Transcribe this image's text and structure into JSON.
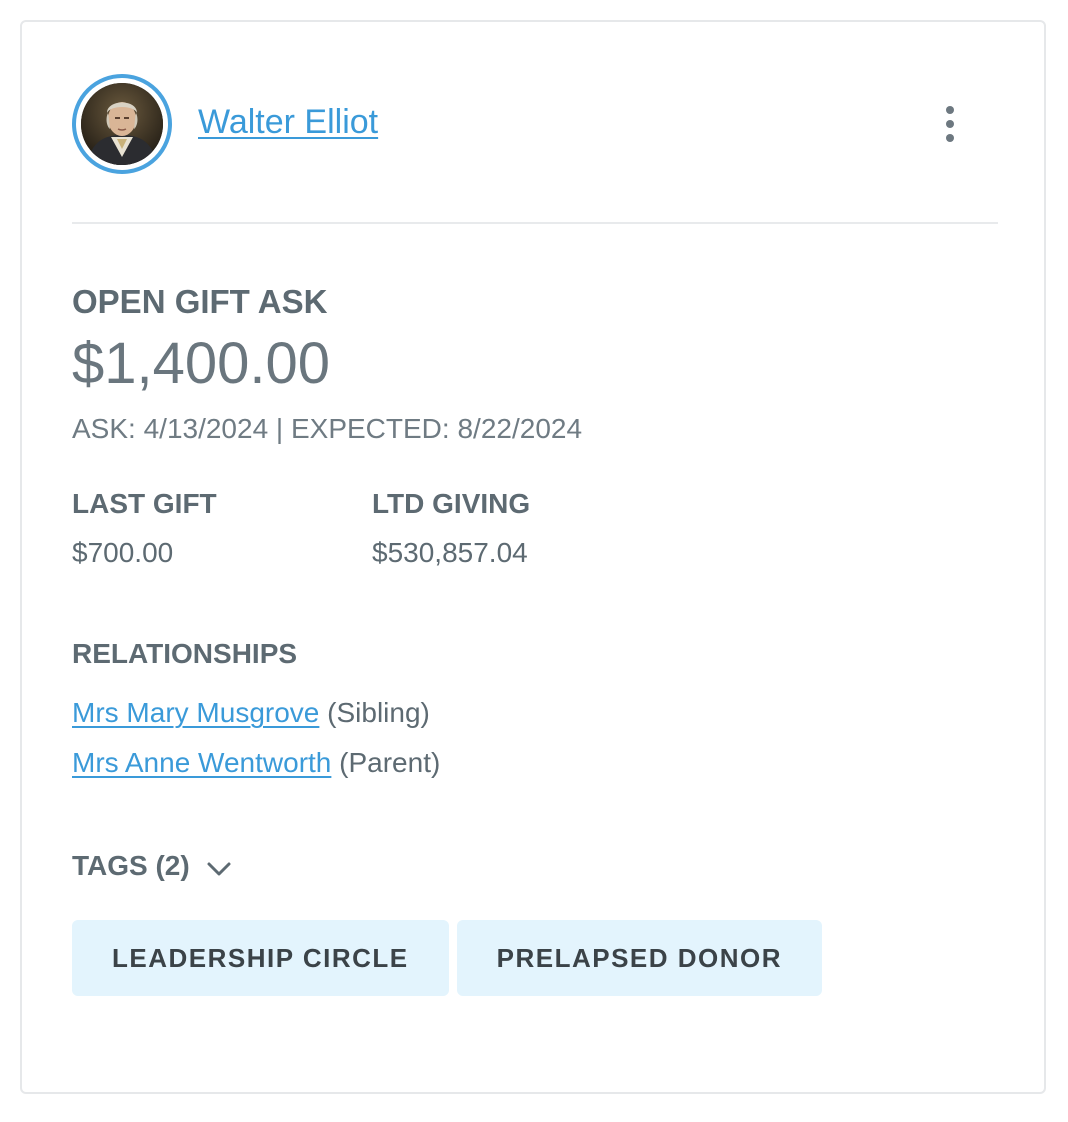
{
  "contact": {
    "name": "Walter Elliot",
    "avatar_icon": "portrait-photo",
    "more_icon": "vertical-ellipsis-icon"
  },
  "open_gift_ask": {
    "label": "OPEN GIFT ASK",
    "amount": "$1,400.00",
    "dates": "ASK: 4/13/2024 | EXPECTED: 8/22/2024"
  },
  "stats": {
    "last_gift_label": "LAST GIFT",
    "last_gift_value": "$700.00",
    "ltd_giving_label": "LTD GIVING",
    "ltd_giving_value": "$530,857.04"
  },
  "relationships": {
    "label": "RELATIONSHIPS",
    "items": [
      {
        "name": "Mrs Mary Musgrove",
        "relation": "(Sibling)"
      },
      {
        "name": "Mrs Anne Wentworth",
        "relation": "(Parent)"
      }
    ]
  },
  "tags": {
    "label": "TAGS (2)",
    "items": [
      "LEADERSHIP CIRCLE",
      "PRELAPSED DONOR"
    ]
  },
  "colors": {
    "link": "#3a9ad9",
    "avatar_ring": "#4aa3df",
    "tag_background": "#e3f4fd",
    "text": "#5d6a72"
  }
}
